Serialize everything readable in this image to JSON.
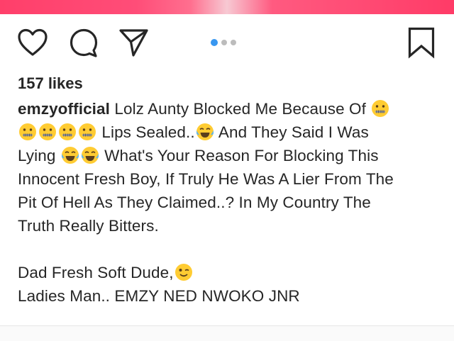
{
  "post": {
    "likes": "157 likes",
    "username": "emzyofficial",
    "caption": {
      "l1": " Lolz Aunty Blocked Me Because Of ",
      "l2": " Lips Sealed..",
      "l2b": " And They Said I Was",
      "l3a": "Lying ",
      "l3b": " What's Your Reason For Blocking This",
      "l4": "Innocent Fresh Boy, If Truly He Was A Lier From The",
      "l5": "Pit Of Hell As They Claimed..? In My Country The",
      "l6": "Truth Really Bitters.",
      "l7": "Dad Fresh Soft Dude,",
      "l8": "Ladies Man.. EMZY NED NWOKO JNR"
    }
  },
  "carousel": {
    "count": 3,
    "active": 1
  },
  "icons": {
    "like": "heart-icon",
    "comment": "comment-bubble-icon",
    "share": "paper-plane-icon",
    "save": "bookmark-icon",
    "zipper": "zipper-mouth-face-emoji",
    "laugh": "tears-of-joy-emoji",
    "wink": "winking-face-emoji"
  },
  "colors": {
    "text": "#262626",
    "accent_dot": "#3897f0",
    "emoji_yellow": "#ffcc33"
  }
}
